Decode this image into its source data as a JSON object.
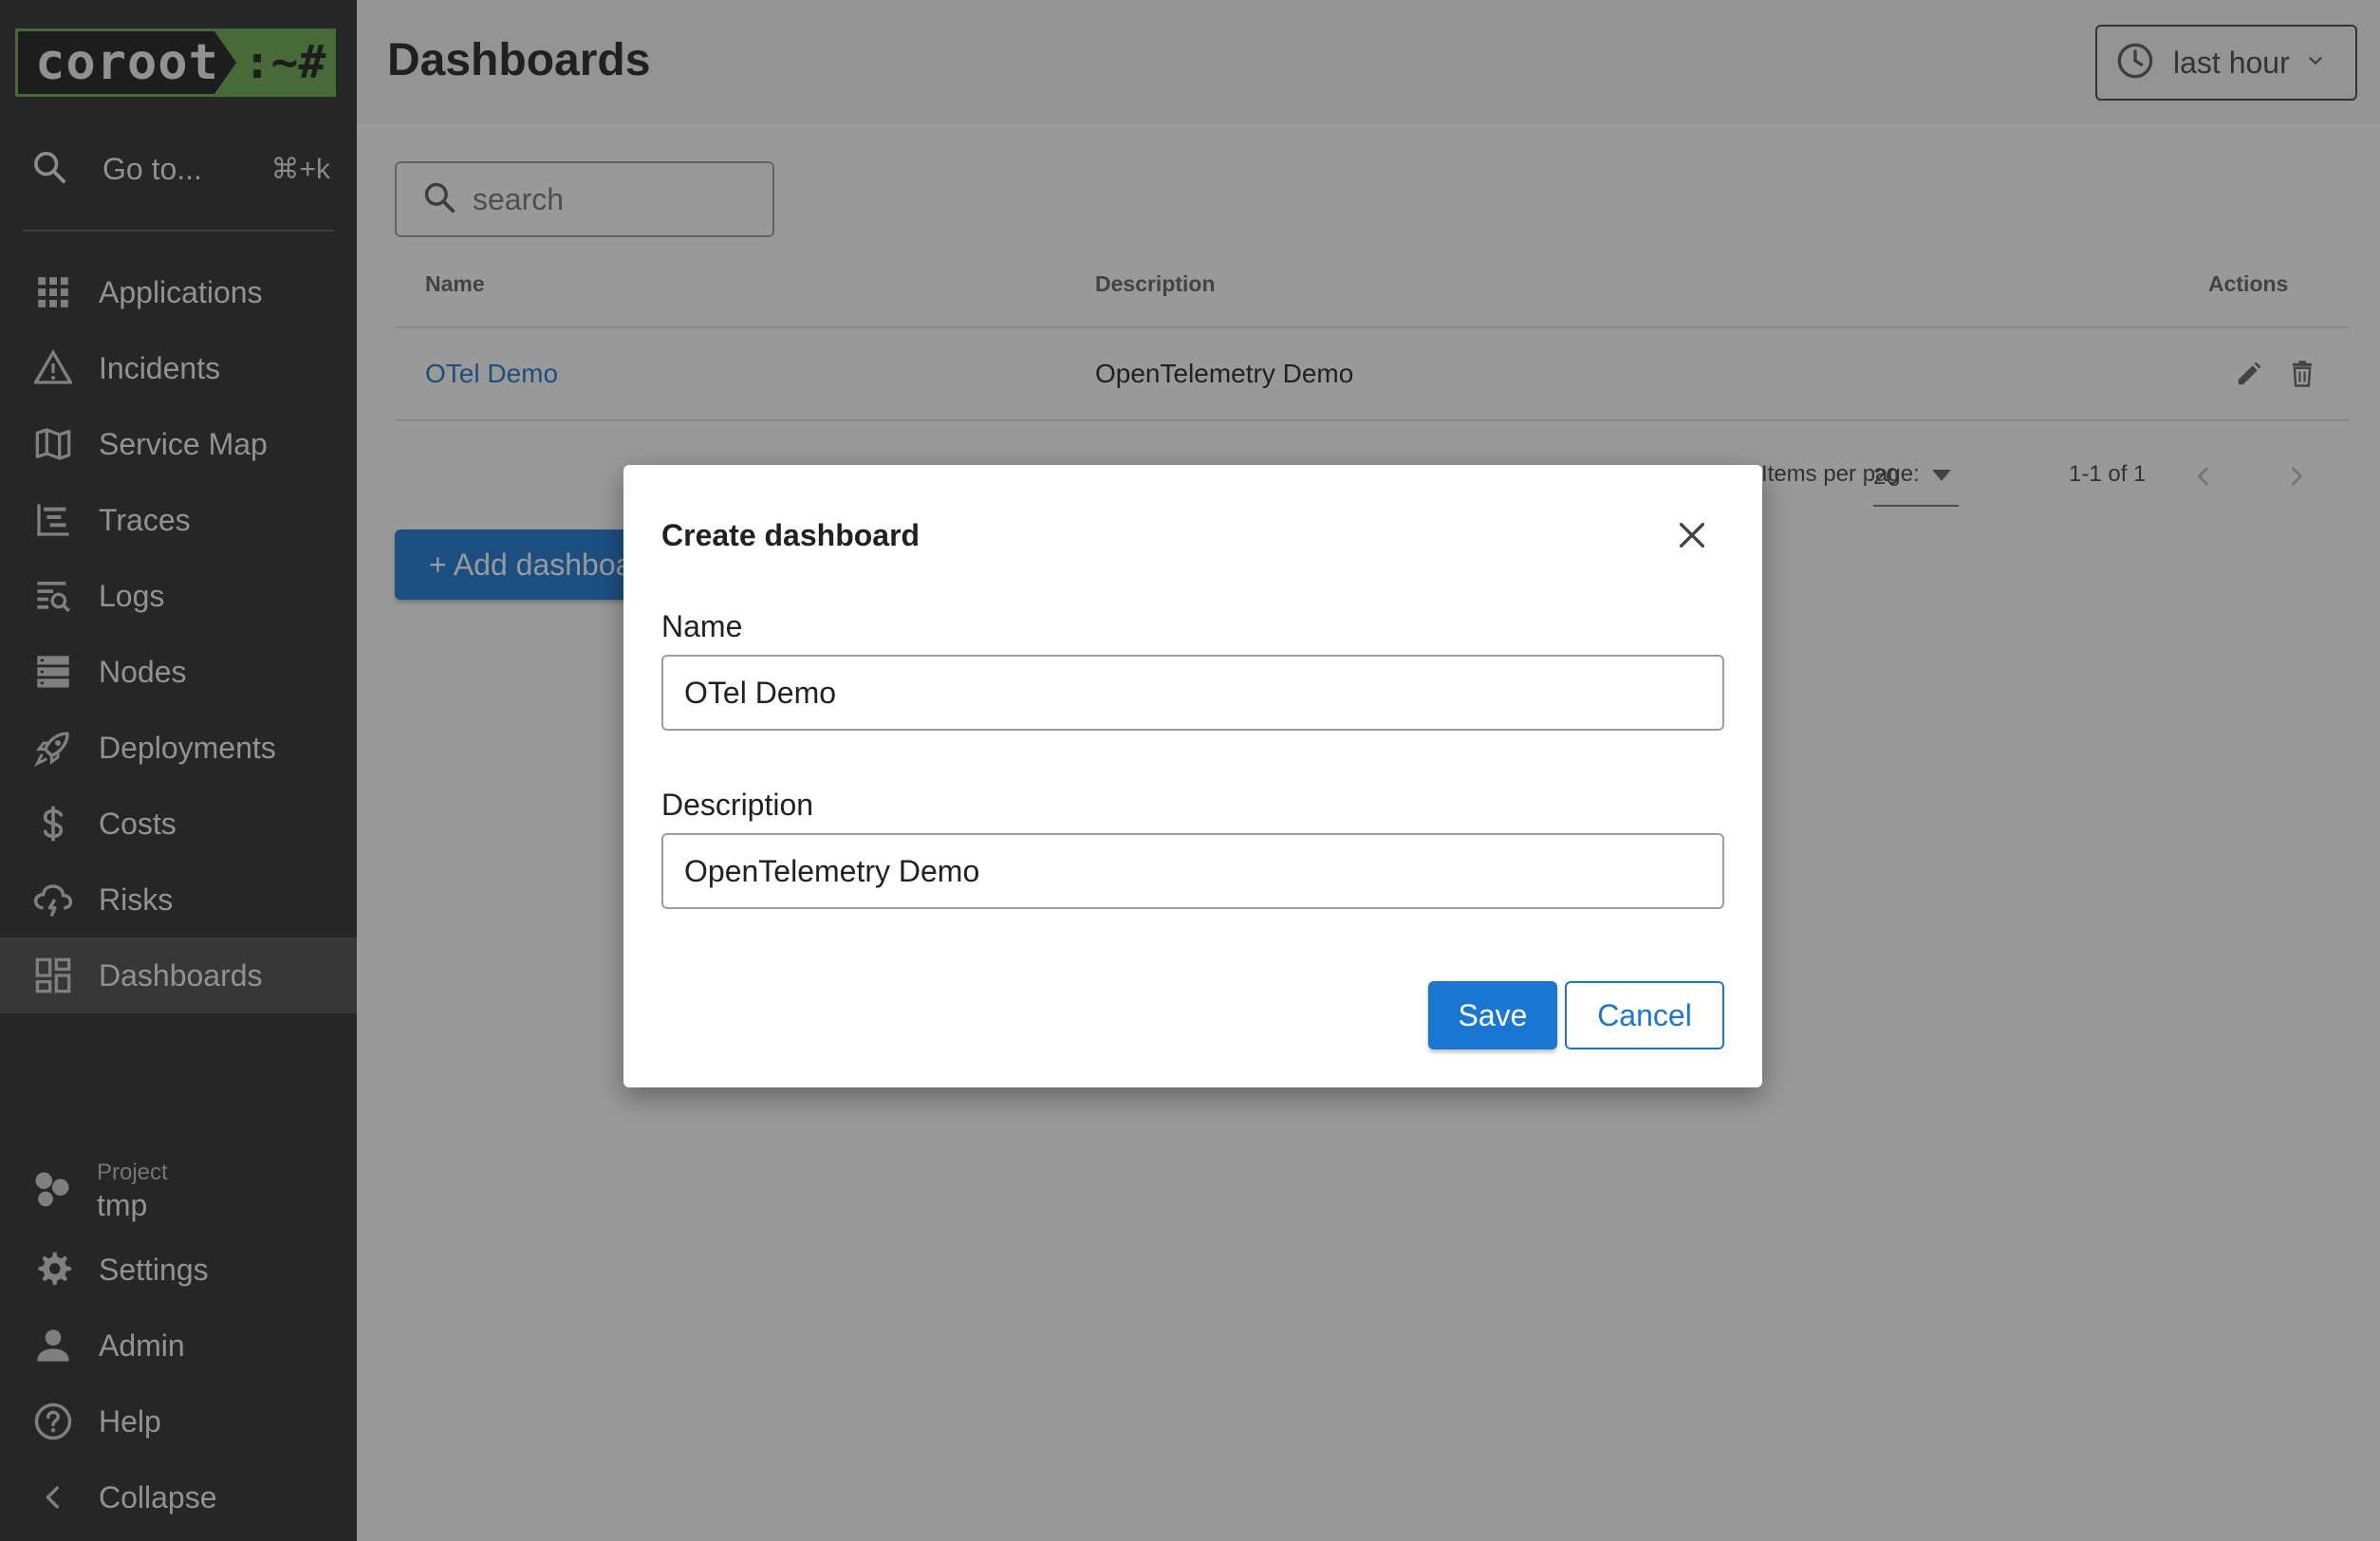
{
  "app": {
    "logo_main": "coroot",
    "logo_suffix": ":~#"
  },
  "sidebar": {
    "goto_label": "Go to...",
    "goto_shortcut": "⌘+k",
    "items": [
      {
        "label": "Applications",
        "icon": "grid-icon"
      },
      {
        "label": "Incidents",
        "icon": "warning-icon"
      },
      {
        "label": "Service Map",
        "icon": "map-icon"
      },
      {
        "label": "Traces",
        "icon": "traces-icon"
      },
      {
        "label": "Logs",
        "icon": "logs-search-icon"
      },
      {
        "label": "Nodes",
        "icon": "server-icon"
      },
      {
        "label": "Deployments",
        "icon": "rocket-icon"
      },
      {
        "label": "Costs",
        "icon": "dollar-icon"
      },
      {
        "label": "Risks",
        "icon": "cloud-alert-icon"
      },
      {
        "label": "Dashboards",
        "icon": "dashboard-icon",
        "active": true
      }
    ],
    "project": {
      "label": "Project",
      "name": "tmp"
    },
    "bottom_items": [
      {
        "label": "Settings",
        "icon": "gear-icon"
      },
      {
        "label": "Admin",
        "icon": "person-icon"
      },
      {
        "label": "Help",
        "icon": "help-icon"
      },
      {
        "label": "Collapse",
        "icon": "chevron-left-icon"
      }
    ]
  },
  "header": {
    "title": "Dashboards",
    "time_range": "last hour"
  },
  "search": {
    "placeholder": "search",
    "value": ""
  },
  "table": {
    "columns": {
      "name": "Name",
      "description": "Description",
      "actions": "Actions"
    },
    "rows": [
      {
        "name": "OTel Demo",
        "description": "OpenTelemetry Demo"
      }
    ]
  },
  "pagination": {
    "per_page_label": "Items per page:",
    "per_page_value": "20",
    "range": "1-1 of 1"
  },
  "add_button": "+ Add dashboard",
  "dialog": {
    "title": "Create dashboard",
    "name_label": "Name",
    "name_value": "OTel Demo",
    "description_label": "Description",
    "description_value": "OpenTelemetry Demo",
    "save": "Save",
    "cancel": "Cancel"
  },
  "colors": {
    "sidebar_bg": "#2b2b2b",
    "accent": "#1976d2",
    "logo_green": "#6aa84f"
  }
}
